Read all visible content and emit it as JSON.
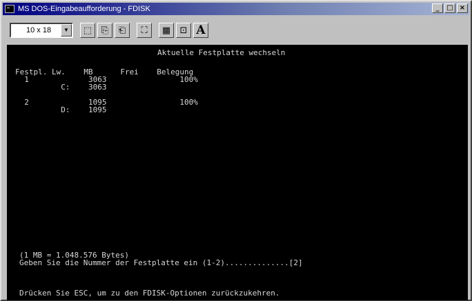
{
  "window": {
    "title": "MS DOS-Eingabeaufforderung - FDISK",
    "minimize_glyph": "_",
    "maximize_glyph": "□",
    "close_glyph": "×"
  },
  "toolbar": {
    "font_size": "10 x 18",
    "dropdown_glyph": "▼",
    "tools": [
      {
        "name": "mark-tool",
        "glyph": "⬚"
      },
      {
        "name": "copy-tool",
        "glyph": "⎘"
      },
      {
        "name": "paste-tool",
        "glyph": "⎗"
      },
      {
        "name": "fullscreen-tool",
        "glyph": "⛶"
      },
      {
        "name": "properties-tool",
        "glyph": "▦"
      },
      {
        "name": "background-tool",
        "glyph": "⊡"
      },
      {
        "name": "font-tool",
        "glyph": "A"
      }
    ]
  },
  "console": {
    "heading": "Aktuelle Festplatte wechseln",
    "header_row": "Festpl. Lw.    MB      Frei    Belegung",
    "rows": [
      "  1             3063                100%",
      "          C:    3063",
      "  2             1095                100%",
      "          D:    1095"
    ],
    "mb_note": "(1 MB = 1.048.576 Bytes)",
    "prompt": "Geben Sie die Nummer der Festplatte ein (1-2)..............[2]",
    "esc_hint": "Drücken Sie ESC, um zu den FDISK-Optionen zurückzukehren."
  },
  "colors": {
    "console_bg": "#000000",
    "console_fg": "#d8d8d8",
    "titlebar": "#000080"
  }
}
